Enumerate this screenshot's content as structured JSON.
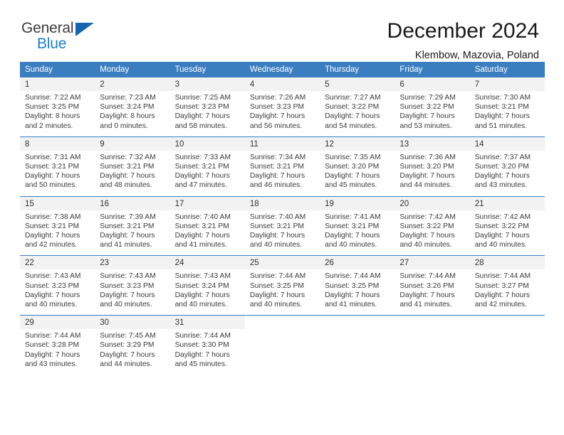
{
  "brand": {
    "name_part1": "General",
    "name_part2": "Blue",
    "flag_icon": "triangle-flag-icon"
  },
  "header": {
    "month_title": "December 2024",
    "location": "Klembow, Mazovia, Poland"
  },
  "colors": {
    "header_blue": "#3a7ec0",
    "brand_blue": "#1c7fd0",
    "daynum_band": "#f2f2f2",
    "text": "#3b3b3b"
  },
  "calendar": {
    "weekday_headers": [
      "Sunday",
      "Monday",
      "Tuesday",
      "Wednesday",
      "Thursday",
      "Friday",
      "Saturday"
    ],
    "weeks": [
      [
        {
          "day": "1",
          "sunrise": "Sunrise: 7:22 AM",
          "sunset": "Sunset: 3:25 PM",
          "daylight1": "Daylight: 8 hours",
          "daylight2": "and 2 minutes."
        },
        {
          "day": "2",
          "sunrise": "Sunrise: 7:23 AM",
          "sunset": "Sunset: 3:24 PM",
          "daylight1": "Daylight: 8 hours",
          "daylight2": "and 0 minutes."
        },
        {
          "day": "3",
          "sunrise": "Sunrise: 7:25 AM",
          "sunset": "Sunset: 3:23 PM",
          "daylight1": "Daylight: 7 hours",
          "daylight2": "and 58 minutes."
        },
        {
          "day": "4",
          "sunrise": "Sunrise: 7:26 AM",
          "sunset": "Sunset: 3:23 PM",
          "daylight1": "Daylight: 7 hours",
          "daylight2": "and 56 minutes."
        },
        {
          "day": "5",
          "sunrise": "Sunrise: 7:27 AM",
          "sunset": "Sunset: 3:22 PM",
          "daylight1": "Daylight: 7 hours",
          "daylight2": "and 54 minutes."
        },
        {
          "day": "6",
          "sunrise": "Sunrise: 7:29 AM",
          "sunset": "Sunset: 3:22 PM",
          "daylight1": "Daylight: 7 hours",
          "daylight2": "and 53 minutes."
        },
        {
          "day": "7",
          "sunrise": "Sunrise: 7:30 AM",
          "sunset": "Sunset: 3:21 PM",
          "daylight1": "Daylight: 7 hours",
          "daylight2": "and 51 minutes."
        }
      ],
      [
        {
          "day": "8",
          "sunrise": "Sunrise: 7:31 AM",
          "sunset": "Sunset: 3:21 PM",
          "daylight1": "Daylight: 7 hours",
          "daylight2": "and 50 minutes."
        },
        {
          "day": "9",
          "sunrise": "Sunrise: 7:32 AM",
          "sunset": "Sunset: 3:21 PM",
          "daylight1": "Daylight: 7 hours",
          "daylight2": "and 48 minutes."
        },
        {
          "day": "10",
          "sunrise": "Sunrise: 7:33 AM",
          "sunset": "Sunset: 3:21 PM",
          "daylight1": "Daylight: 7 hours",
          "daylight2": "and 47 minutes."
        },
        {
          "day": "11",
          "sunrise": "Sunrise: 7:34 AM",
          "sunset": "Sunset: 3:21 PM",
          "daylight1": "Daylight: 7 hours",
          "daylight2": "and 46 minutes."
        },
        {
          "day": "12",
          "sunrise": "Sunrise: 7:35 AM",
          "sunset": "Sunset: 3:20 PM",
          "daylight1": "Daylight: 7 hours",
          "daylight2": "and 45 minutes."
        },
        {
          "day": "13",
          "sunrise": "Sunrise: 7:36 AM",
          "sunset": "Sunset: 3:20 PM",
          "daylight1": "Daylight: 7 hours",
          "daylight2": "and 44 minutes."
        },
        {
          "day": "14",
          "sunrise": "Sunrise: 7:37 AM",
          "sunset": "Sunset: 3:20 PM",
          "daylight1": "Daylight: 7 hours",
          "daylight2": "and 43 minutes."
        }
      ],
      [
        {
          "day": "15",
          "sunrise": "Sunrise: 7:38 AM",
          "sunset": "Sunset: 3:21 PM",
          "daylight1": "Daylight: 7 hours",
          "daylight2": "and 42 minutes."
        },
        {
          "day": "16",
          "sunrise": "Sunrise: 7:39 AM",
          "sunset": "Sunset: 3:21 PM",
          "daylight1": "Daylight: 7 hours",
          "daylight2": "and 41 minutes."
        },
        {
          "day": "17",
          "sunrise": "Sunrise: 7:40 AM",
          "sunset": "Sunset: 3:21 PM",
          "daylight1": "Daylight: 7 hours",
          "daylight2": "and 41 minutes."
        },
        {
          "day": "18",
          "sunrise": "Sunrise: 7:40 AM",
          "sunset": "Sunset: 3:21 PM",
          "daylight1": "Daylight: 7 hours",
          "daylight2": "and 40 minutes."
        },
        {
          "day": "19",
          "sunrise": "Sunrise: 7:41 AM",
          "sunset": "Sunset: 3:21 PM",
          "daylight1": "Daylight: 7 hours",
          "daylight2": "and 40 minutes."
        },
        {
          "day": "20",
          "sunrise": "Sunrise: 7:42 AM",
          "sunset": "Sunset: 3:22 PM",
          "daylight1": "Daylight: 7 hours",
          "daylight2": "and 40 minutes."
        },
        {
          "day": "21",
          "sunrise": "Sunrise: 7:42 AM",
          "sunset": "Sunset: 3:22 PM",
          "daylight1": "Daylight: 7 hours",
          "daylight2": "and 40 minutes."
        }
      ],
      [
        {
          "day": "22",
          "sunrise": "Sunrise: 7:43 AM",
          "sunset": "Sunset: 3:23 PM",
          "daylight1": "Daylight: 7 hours",
          "daylight2": "and 40 minutes."
        },
        {
          "day": "23",
          "sunrise": "Sunrise: 7:43 AM",
          "sunset": "Sunset: 3:23 PM",
          "daylight1": "Daylight: 7 hours",
          "daylight2": "and 40 minutes."
        },
        {
          "day": "24",
          "sunrise": "Sunrise: 7:43 AM",
          "sunset": "Sunset: 3:24 PM",
          "daylight1": "Daylight: 7 hours",
          "daylight2": "and 40 minutes."
        },
        {
          "day": "25",
          "sunrise": "Sunrise: 7:44 AM",
          "sunset": "Sunset: 3:25 PM",
          "daylight1": "Daylight: 7 hours",
          "daylight2": "and 40 minutes."
        },
        {
          "day": "26",
          "sunrise": "Sunrise: 7:44 AM",
          "sunset": "Sunset: 3:25 PM",
          "daylight1": "Daylight: 7 hours",
          "daylight2": "and 41 minutes."
        },
        {
          "day": "27",
          "sunrise": "Sunrise: 7:44 AM",
          "sunset": "Sunset: 3:26 PM",
          "daylight1": "Daylight: 7 hours",
          "daylight2": "and 41 minutes."
        },
        {
          "day": "28",
          "sunrise": "Sunrise: 7:44 AM",
          "sunset": "Sunset: 3:27 PM",
          "daylight1": "Daylight: 7 hours",
          "daylight2": "and 42 minutes."
        }
      ],
      [
        {
          "day": "29",
          "sunrise": "Sunrise: 7:44 AM",
          "sunset": "Sunset: 3:28 PM",
          "daylight1": "Daylight: 7 hours",
          "daylight2": "and 43 minutes."
        },
        {
          "day": "30",
          "sunrise": "Sunrise: 7:45 AM",
          "sunset": "Sunset: 3:29 PM",
          "daylight1": "Daylight: 7 hours",
          "daylight2": "and 44 minutes."
        },
        {
          "day": "31",
          "sunrise": "Sunrise: 7:44 AM",
          "sunset": "Sunset: 3:30 PM",
          "daylight1": "Daylight: 7 hours",
          "daylight2": "and 45 minutes."
        },
        {
          "day": "",
          "sunrise": "",
          "sunset": "",
          "daylight1": "",
          "daylight2": ""
        },
        {
          "day": "",
          "sunrise": "",
          "sunset": "",
          "daylight1": "",
          "daylight2": ""
        },
        {
          "day": "",
          "sunrise": "",
          "sunset": "",
          "daylight1": "",
          "daylight2": ""
        },
        {
          "day": "",
          "sunrise": "",
          "sunset": "",
          "daylight1": "",
          "daylight2": ""
        }
      ]
    ]
  }
}
